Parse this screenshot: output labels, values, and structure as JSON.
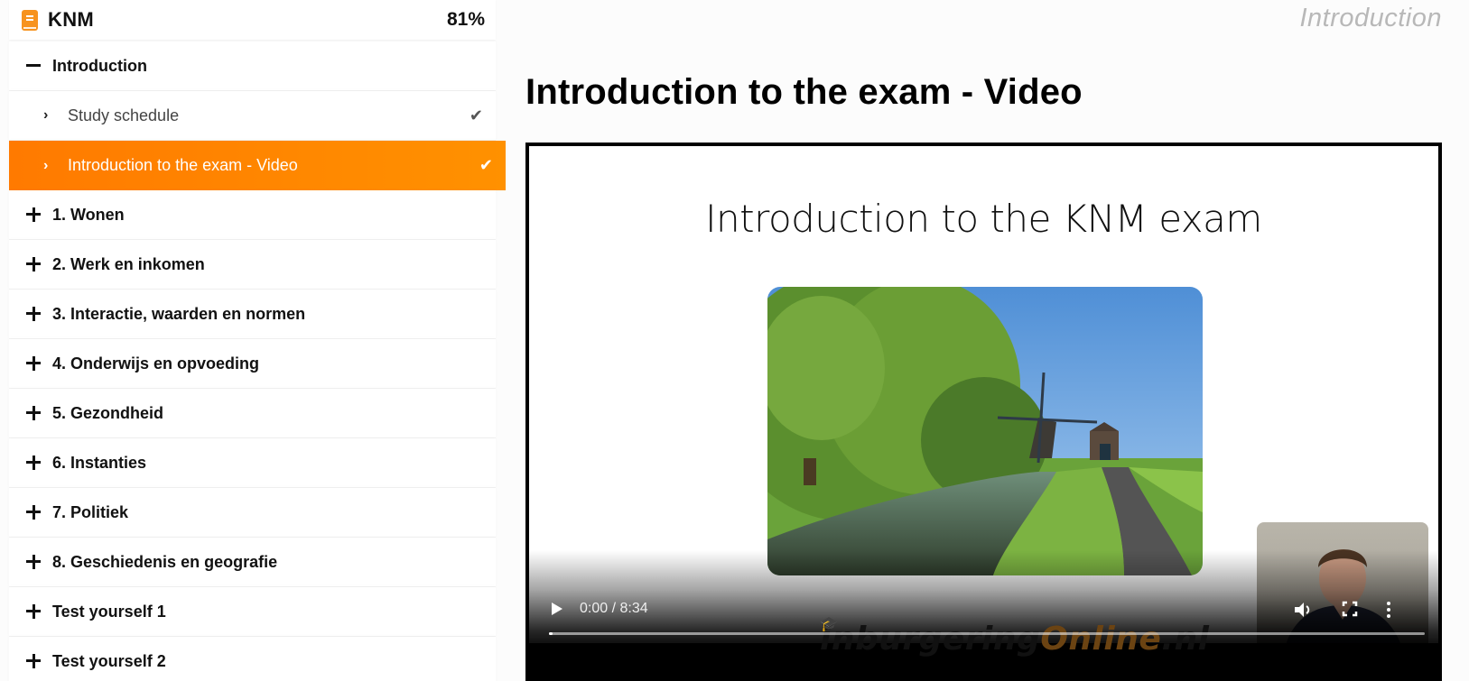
{
  "course": {
    "title": "KNM",
    "progress": "81%",
    "icon": "book-icon"
  },
  "menu": {
    "current_section": {
      "label": "Introduction",
      "expanded": true,
      "lessons": [
        {
          "label": "Study schedule",
          "completed": true,
          "active": false
        },
        {
          "label": "Introduction to the exam - Video",
          "completed": true,
          "active": true
        }
      ]
    },
    "sections": [
      {
        "label": "1. Wonen"
      },
      {
        "label": "2. Werk en inkomen"
      },
      {
        "label": "3. Interactie, waarden en normen"
      },
      {
        "label": "4. Onderwijs en opvoeding"
      },
      {
        "label": "5. Gezondheid"
      },
      {
        "label": "6. Instanties"
      },
      {
        "label": "7. Politiek"
      },
      {
        "label": "8. Geschiedenis en geografie"
      },
      {
        "label": "Test yourself 1"
      },
      {
        "label": "Test yourself 2"
      }
    ]
  },
  "icons": {
    "chevron": "›",
    "check": "✔"
  },
  "main": {
    "breadcrumb": "Introduction",
    "title": "Introduction to the exam - Video"
  },
  "video": {
    "slide_title": "Introduction to the KNM exam",
    "watermark_main": "inburgering",
    "watermark_accent": "Online",
    "watermark_suffix": ".nl",
    "current_time": "0:00",
    "duration": "8:34",
    "time_label": "0:00 / 8:34",
    "progress": 0.0
  },
  "colors": {
    "accent": "#ff8200",
    "accent_icon": "#f7931e",
    "breadcrumb": "#b8b8b8"
  }
}
